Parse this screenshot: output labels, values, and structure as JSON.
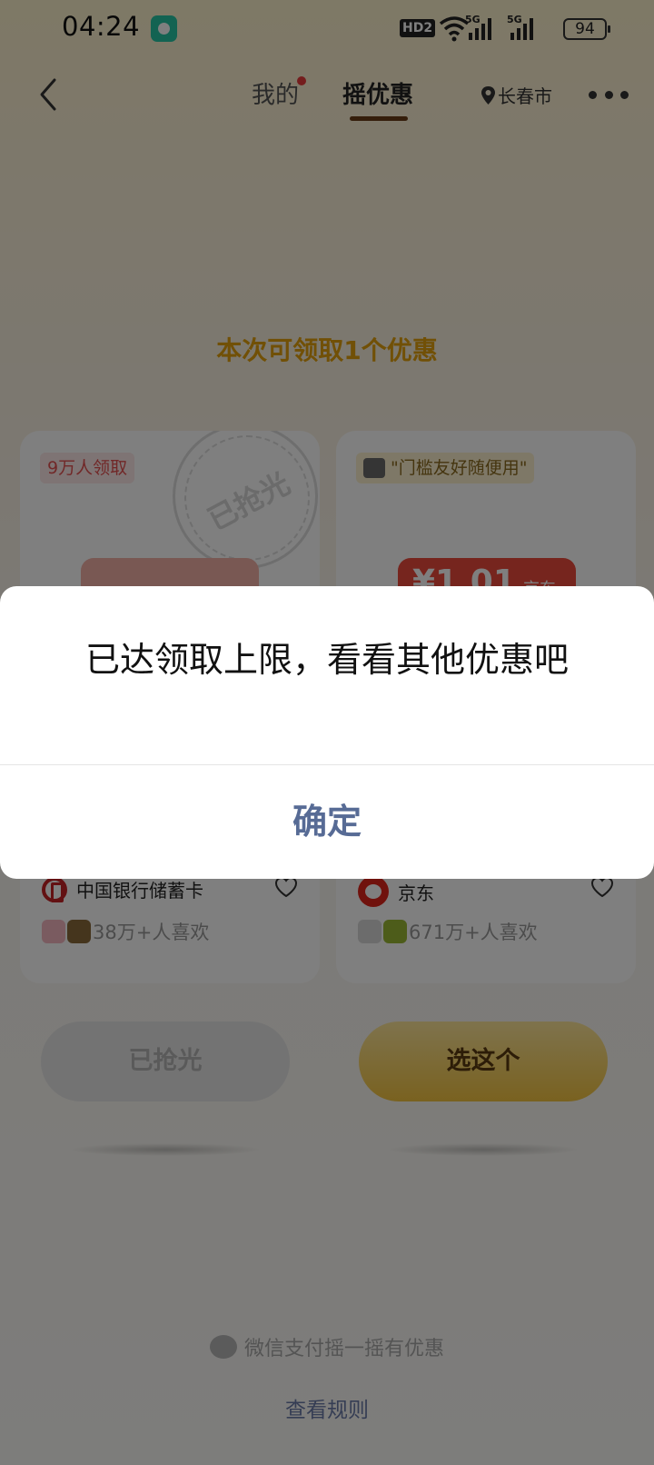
{
  "status_bar": {
    "time": "04:24",
    "network_hd": "HD2",
    "signal_1_label": "5G",
    "signal_2_label": "5G",
    "battery": "94",
    "app_icon": "message-app-icon"
  },
  "nav": {
    "back_icon": "chevron-left-icon",
    "tabs": [
      {
        "label": "我的",
        "has_dot": true,
        "active": false
      },
      {
        "label": "摇优惠",
        "active": true
      }
    ],
    "location": "长春市",
    "more_icon": "more-dots-icon"
  },
  "headline": "本次可领取1个优惠",
  "cards": [
    {
      "tag": "9万人领取",
      "stamp_text": "已抢光",
      "merchant": "中国银行储蓄卡",
      "merchant_icon": "boc-logo-icon",
      "likes": "38万+人喜欢"
    },
    {
      "tag": "\"门槛友好随便用\"",
      "coupon_amount": "¥1.01",
      "coupon_label": "京东",
      "merchant": "京东",
      "merchant_icon": "jd-logo-icon",
      "likes": "671万+人喜欢"
    }
  ],
  "buttons": {
    "sold_out": "已抢光",
    "choose": "选这个"
  },
  "footer": {
    "brand": "微信支付摇一摇有优惠",
    "rules": "查看规则"
  },
  "dialog": {
    "message": "已达领取上限，看看其他优惠吧",
    "confirm": "确定"
  },
  "colors": {
    "accent_gold": "#e2a00c",
    "dialog_button": "#576b95",
    "coupon_red": "#ec4a3c"
  }
}
